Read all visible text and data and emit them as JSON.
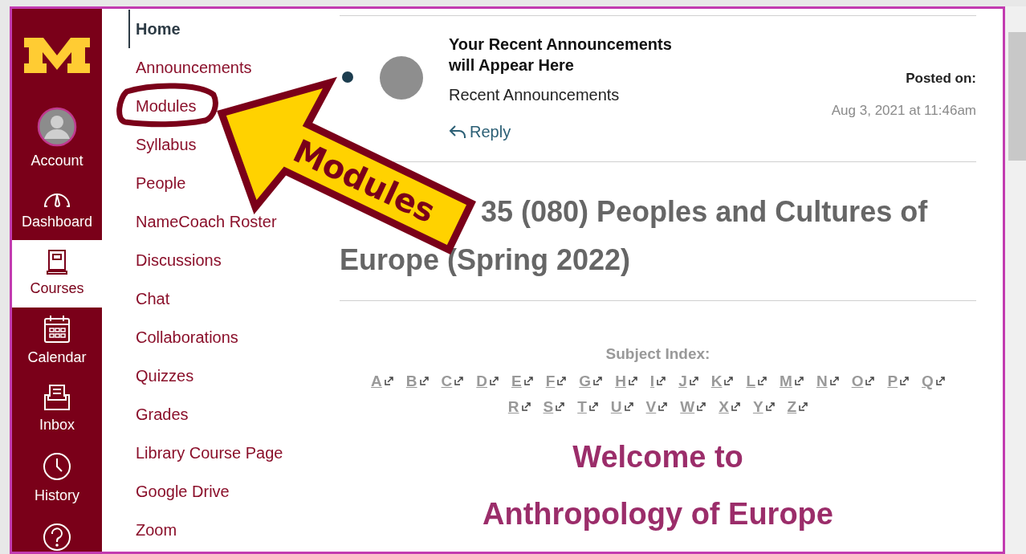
{
  "global_nav": [
    {
      "kind": "logo",
      "selected": false
    },
    {
      "kind": "account",
      "label": "Account",
      "selected": false
    },
    {
      "kind": "dashboard",
      "label": "Dashboard",
      "selected": false
    },
    {
      "kind": "courses",
      "label": "Courses",
      "selected": true
    },
    {
      "kind": "calendar",
      "label": "Calendar",
      "selected": false
    },
    {
      "kind": "inbox",
      "label": "Inbox",
      "selected": false
    },
    {
      "kind": "history",
      "label": "History",
      "selected": false
    },
    {
      "kind": "help",
      "selected": false
    }
  ],
  "course_nav": [
    {
      "label": "Home",
      "selected": true
    },
    {
      "label": "Announcements",
      "selected": false
    },
    {
      "label": "Modules",
      "selected": false
    },
    {
      "label": "Syllabus",
      "selected": false
    },
    {
      "label": "People",
      "selected": false
    },
    {
      "label": "NameCoach Roster",
      "selected": false
    },
    {
      "label": "Discussions",
      "selected": false
    },
    {
      "label": "Chat",
      "selected": false
    },
    {
      "label": "Collaborations",
      "selected": false
    },
    {
      "label": "Quizzes",
      "selected": false
    },
    {
      "label": "Grades",
      "selected": false
    },
    {
      "label": "Library Course Page",
      "selected": false
    },
    {
      "label": "Google Drive",
      "selected": false
    },
    {
      "label": "Zoom",
      "selected": false
    }
  ],
  "announcement": {
    "title": "Your Recent Announcements will Appear Here",
    "subtitle": "Recent Announcements",
    "reply": "Reply",
    "posted_label": "Posted on:",
    "posted_date": "Aug 3, 2021 at 11:46am",
    "unread": true
  },
  "heading": [
    "35 (080) Peoples and Cultures of",
    "Europe (Spring 2022)"
  ],
  "subject_index": {
    "label": "Subject Index:",
    "letters": [
      "A",
      "B",
      "C",
      "D",
      "E",
      "F",
      "G",
      "H",
      "I",
      "J",
      "K",
      "L",
      "M",
      "N",
      "O",
      "P",
      "Q",
      "R",
      "S",
      "T",
      "U",
      "V",
      "W",
      "X",
      "Y",
      "Z"
    ]
  },
  "welcome": [
    "Welcome to",
    "Anthropology of Europe"
  ],
  "callout": {
    "label": "Modules"
  }
}
